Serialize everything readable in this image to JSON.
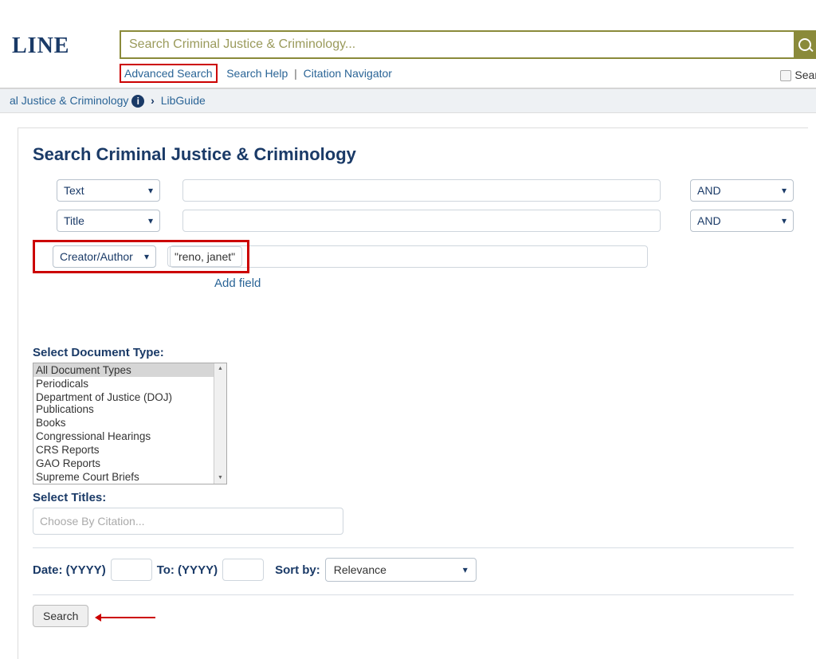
{
  "logo_fragment": "LINE",
  "top_search": {
    "placeholder": "Search Criminal Justice & Criminology..."
  },
  "sub_links": {
    "advanced": "Advanced Search",
    "help": "Search Help",
    "citation_nav": "Citation Navigator"
  },
  "right_check_label": "Searc",
  "breadcrumb": {
    "collection_fragment": "al Justice & Criminology",
    "libguide": "LibGuide"
  },
  "heading": "Search Criminal Justice & Criminology",
  "rows": [
    {
      "field": "Text",
      "term": "",
      "bool": "AND"
    },
    {
      "field": "Title",
      "term": "",
      "bool": "AND"
    },
    {
      "field": "Creator/Author",
      "term": "\"reno, janet\""
    }
  ],
  "add_field": "Add field",
  "doc_type": {
    "label": "Select Document Type:",
    "options": [
      "All Document Types",
      "Periodicals",
      "Department of Justice (DOJ) Publications",
      "Books",
      "Congressional Hearings",
      "CRS Reports",
      "GAO Reports",
      "Supreme Court Briefs"
    ],
    "selected_index": 0
  },
  "select_titles": {
    "label": "Select Titles:",
    "placeholder": "Choose By Citation..."
  },
  "date": {
    "label_from": "Date: (YYYY)",
    "label_to": "To: (YYYY)",
    "sort_label": "Sort by:",
    "sort_value": "Relevance"
  },
  "search_button": "Search"
}
